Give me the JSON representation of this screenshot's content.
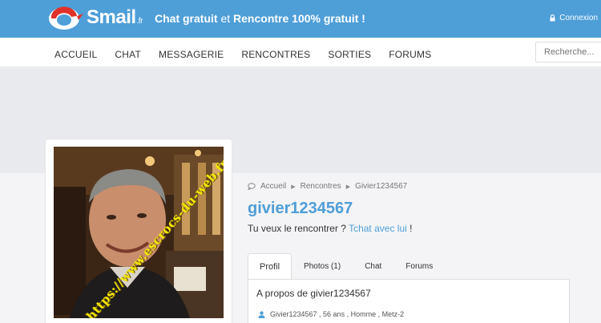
{
  "brand": {
    "name": "Smail",
    "tld": ".fr"
  },
  "tagline": {
    "part1": "Chat gratuit",
    "part2": " et ",
    "part3": "Rencontre 100% gratuit !"
  },
  "header": {
    "connexion_label": "Connexion"
  },
  "nav": {
    "items": [
      "ACCUEIL",
      "CHAT",
      "MESSAGERIE",
      "RENCONTRES",
      "SORTIES",
      "FORUMS"
    ]
  },
  "search": {
    "placeholder": "Recherche..."
  },
  "photo": {
    "watermark": "https://www.escrocs-du-web.fr"
  },
  "breadcrumb": {
    "items": [
      "Accueil",
      "Rencontres",
      "Givier1234567"
    ]
  },
  "profile": {
    "username": "givier1234567",
    "prompt_text": "Tu veux le rencontrer ? ",
    "prompt_link": "Tchat avec lui",
    "prompt_end": " !"
  },
  "tabs": [
    "Profil",
    "Photos (1)",
    "Chat",
    "Forums"
  ],
  "panel": {
    "title": "A propos de givier1234567",
    "info": "Givier1234567 , 56 ans , Homme , Metz-2"
  },
  "colors": {
    "accent": "#4e9ed8",
    "logo_red": "#e0322a",
    "watermark": "#f4e600"
  }
}
